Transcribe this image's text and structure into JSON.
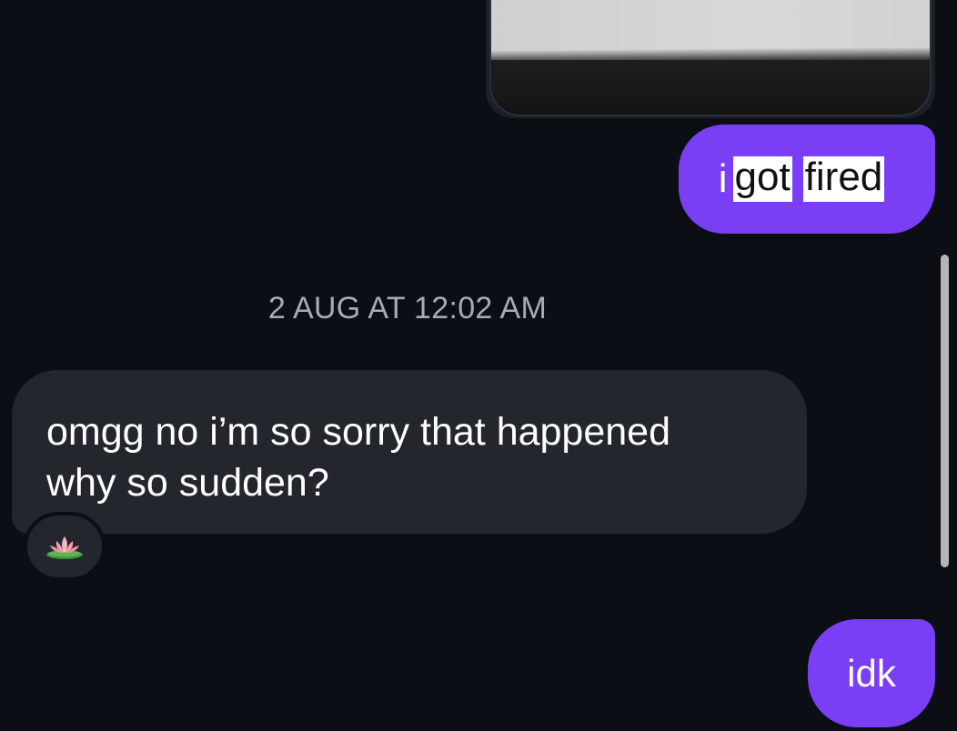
{
  "messages": {
    "fired": {
      "prefix": "i",
      "word1": "got",
      "word2": "fired"
    },
    "timestamp": "2 AUG AT 12:02 AM",
    "incoming": {
      "line1": "omgg no i’m so sorry that happened",
      "line2": "why so sudden?",
      "reaction": "lotus-emoji"
    },
    "idk": "idk"
  },
  "colors": {
    "background": "#0b0e14",
    "outgoing_bubble": "#7a3ff5",
    "incoming_bubble": "#23262d",
    "timestamp_text": "#a7abb3"
  }
}
